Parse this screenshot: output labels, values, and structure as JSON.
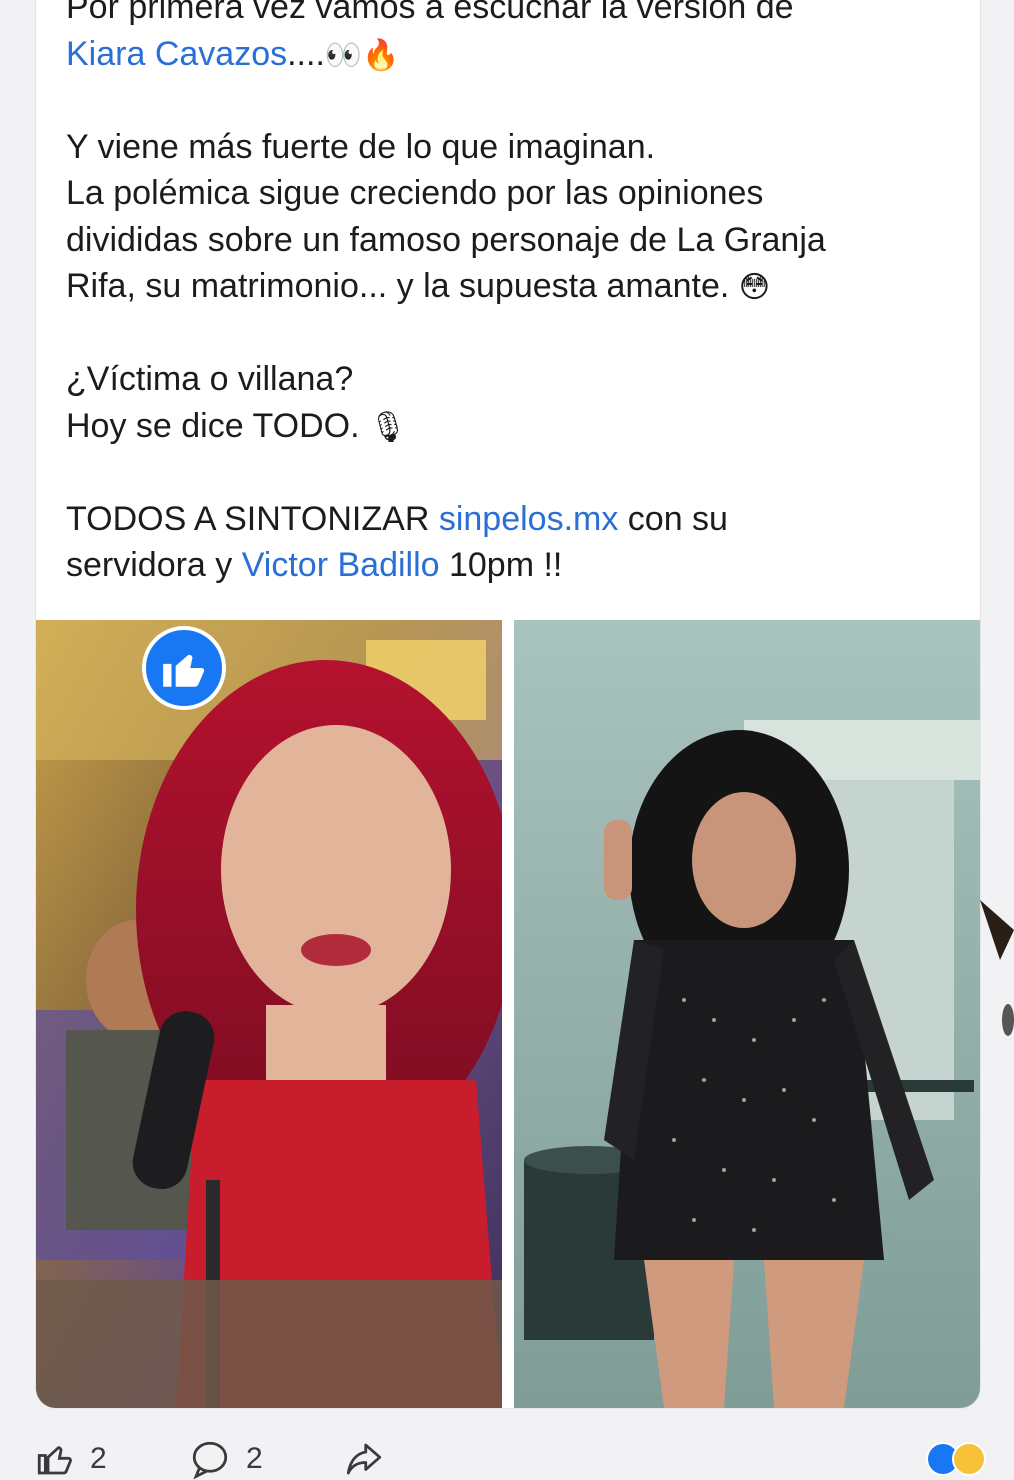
{
  "post": {
    "lines": [
      {
        "parts": [
          {
            "text": "Por primera vez vamos a escuchar la versión de"
          }
        ]
      },
      {
        "parts": [
          {
            "text": "Kiara Cavazos",
            "link": true
          },
          {
            "text": "...."
          },
          {
            "emoji": "👀"
          },
          {
            "emoji": "🔥"
          }
        ]
      },
      {
        "blank": true
      },
      {
        "parts": [
          {
            "text": "Y viene más fuerte de lo que imaginan."
          }
        ]
      },
      {
        "parts": [
          {
            "text": "La polémica sigue creciendo por las opiniones"
          }
        ]
      },
      {
        "parts": [
          {
            "text": "divididas sobre un famoso personaje de La Granja"
          }
        ]
      },
      {
        "parts": [
          {
            "text": "Rifa, su matrimonio... y la supuesta amante. "
          },
          {
            "emoji": "😳"
          }
        ]
      },
      {
        "blank": true
      },
      {
        "parts": [
          {
            "text": "¿Víctima o villana?"
          }
        ]
      },
      {
        "parts": [
          {
            "text": "Hoy se dice TODO. "
          },
          {
            "emoji": "🎙"
          }
        ]
      },
      {
        "blank": true
      },
      {
        "parts": [
          {
            "text": "TODOS A SINTONIZAR "
          },
          {
            "text": "sinpelos.mx",
            "link": true
          },
          {
            "text": " con su"
          }
        ]
      },
      {
        "parts": [
          {
            "text": "servidora y "
          },
          {
            "text": "Victor Badillo",
            "link": true
          },
          {
            "text": " 10pm !!"
          }
        ]
      }
    ]
  },
  "actions": {
    "like_count": "2",
    "comment_count": "2"
  },
  "colors": {
    "link": "#2a6fd6",
    "brand_blue": "#1877f2"
  },
  "icons": {
    "like_badge": "thumbs-up-icon",
    "like_action": "thumbs-up-outline-icon",
    "comment_action": "comment-bubble-icon",
    "share_action": "share-arrow-icon"
  }
}
